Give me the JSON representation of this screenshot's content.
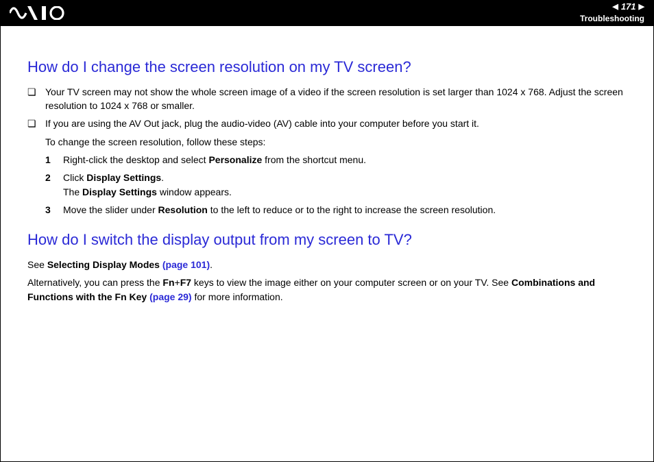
{
  "header": {
    "page_number": "171",
    "section": "Troubleshooting"
  },
  "h1": "How do I change the screen resolution on my TV screen?",
  "b1": "Your TV screen may not show the whole screen image of a video if the screen resolution is set larger than 1024 x 768. Adjust the screen resolution to 1024 x 768 or smaller.",
  "b2": "If you are using the AV Out jack, plug the audio-video (AV) cable into your computer before you start it.",
  "sub1": "To change the screen resolution, follow these steps:",
  "s1a": "Right-click the desktop and select ",
  "s1b": "Personalize",
  "s1c": " from the shortcut menu.",
  "s2a": "Click ",
  "s2b": "Display Settings",
  "s2c": ".",
  "s2d": "The ",
  "s2e": "Display Settings",
  "s2f": " window appears.",
  "s3a": "Move the slider under ",
  "s3b": "Resolution",
  "s3c": " to the left to reduce or to the right to increase the screen resolution.",
  "h2": "How do I switch the display output from my screen to TV?",
  "p2a": "See ",
  "p2b": "Selecting Display Modes ",
  "p2link1": "(page 101)",
  "p2c": ".",
  "p3a": "Alternatively, you can press the ",
  "p3b": "Fn",
  "p3c": "+",
  "p3d": "F7",
  "p3e": " keys to view the image either on your computer screen or on your TV. See ",
  "p3f": "Combinations and Functions with the Fn Key ",
  "p3link2": "(page 29)",
  "p3g": " for more information.",
  "n1": "1",
  "n2": "2",
  "n3": "3"
}
